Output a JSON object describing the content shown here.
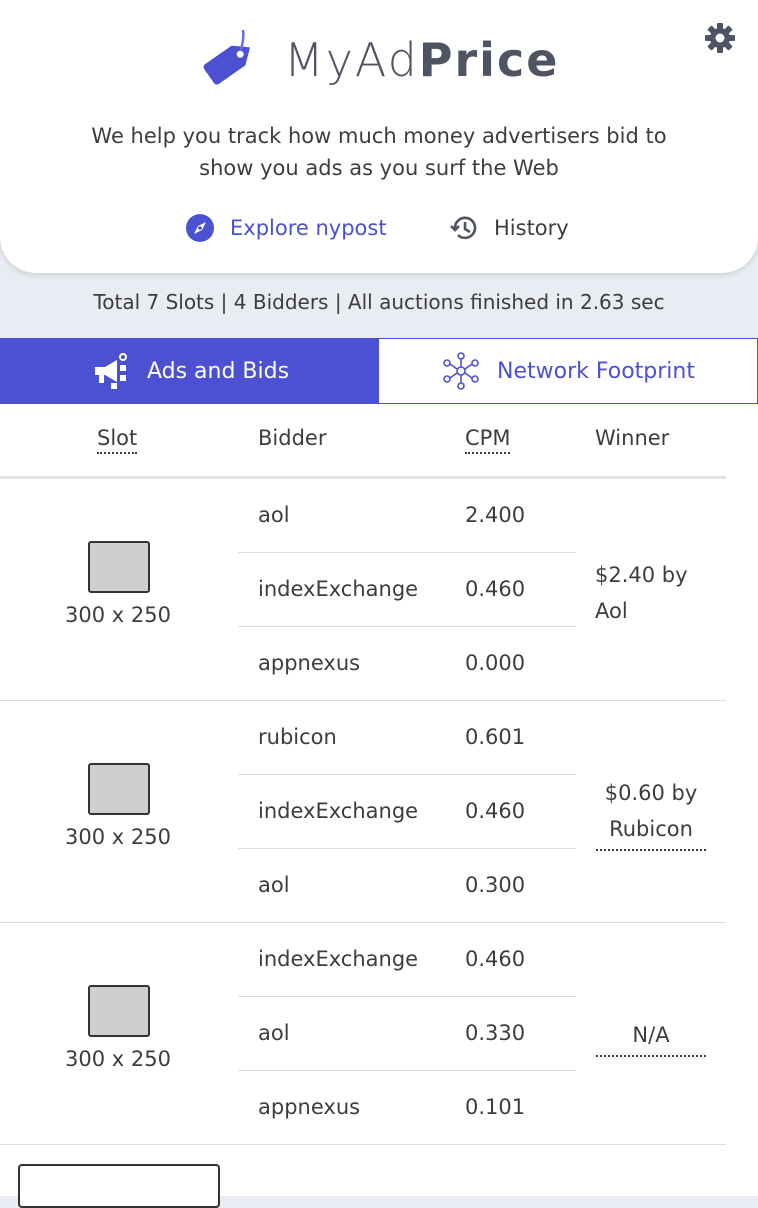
{
  "brand": {
    "name_light": "MyAd",
    "name_bold": "Price",
    "accent": "#4c51d2"
  },
  "tagline": {
    "line1": "We help you track how much money advertisers bid to",
    "line2": "show you ads as you surf the Web"
  },
  "nav": {
    "explore_label": "Explore nypost",
    "history_label": "History"
  },
  "summary": {
    "text": "Total 7 Slots | 4 Bidders | All auctions finished in 2.63 sec"
  },
  "tabs": {
    "ads_bids": "Ads and Bids",
    "network": "Network Footprint"
  },
  "table": {
    "headers": {
      "slot": "Slot",
      "bidder": "Bidder",
      "cpm": "CPM",
      "winner": "Winner"
    },
    "groups": [
      {
        "size": "300 x 250",
        "winner_line1": "$2.40 by",
        "winner_line2": "Aol",
        "bids": [
          {
            "bidder": "aol",
            "cpm": "2.400"
          },
          {
            "bidder": "indexExchange",
            "cpm": "0.460"
          },
          {
            "bidder": "appnexus",
            "cpm": "0.000"
          }
        ]
      },
      {
        "size": "300 x 250",
        "winner_line1": "$0.60 by",
        "winner_line2": "Rubicon",
        "bids": [
          {
            "bidder": "rubicon",
            "cpm": "0.601"
          },
          {
            "bidder": "indexExchange",
            "cpm": "0.460"
          },
          {
            "bidder": "aol",
            "cpm": "0.300"
          }
        ]
      },
      {
        "size": "300 x 250",
        "winner_line1": "N/A",
        "bids": [
          {
            "bidder": "indexExchange",
            "cpm": "0.460"
          },
          {
            "bidder": "aol",
            "cpm": "0.330"
          },
          {
            "bidder": "appnexus",
            "cpm": "0.101"
          }
        ]
      }
    ]
  }
}
